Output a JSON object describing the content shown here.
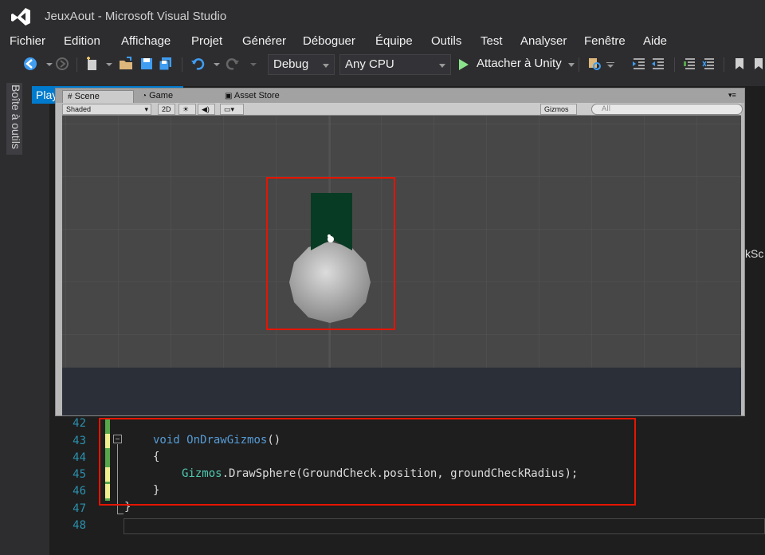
{
  "window": {
    "title": "JeuxAout - Microsoft Visual Studio"
  },
  "menu": [
    "Fichier",
    "Edition",
    "Affichage",
    "Projet",
    "Générer",
    "Déboguer",
    "Équipe",
    "Outils",
    "Test",
    "Analyser",
    "Fenêtre",
    "Aide"
  ],
  "toolbar": {
    "config": "Debug",
    "platform": "Any CPU",
    "attach_label": "Attacher à Unity"
  },
  "toolbox": {
    "label": "Boîte à outils"
  },
  "editor": {
    "doc_tab": "Play",
    "cropped_text": "skSc",
    "lines": [
      {
        "num": "42",
        "code": ""
      },
      {
        "num": "43",
        "code": "void OnDrawGizmos()"
      },
      {
        "num": "44",
        "code": "{"
      },
      {
        "num": "45",
        "code": "Gizmos.DrawSphere(GroundCheck.position, groundCheckRadius);"
      },
      {
        "num": "46",
        "code": "}"
      },
      {
        "num": "47",
        "code": "}"
      },
      {
        "num": "48",
        "code": ""
      }
    ],
    "tokens": {
      "void": "void",
      "method": "OnDrawGizmos",
      "parens": "()",
      "gizmos": "Gizmos",
      "call": ".DrawSphere(GroundCheck.position, groundCheckRadius);"
    }
  },
  "unity": {
    "tabs": [
      "Scene",
      "Game",
      "Asset Store"
    ],
    "shading": "Shaded",
    "mode_2d": "2D",
    "gizmos_label": "Gizmos",
    "search_placeholder": "All"
  }
}
